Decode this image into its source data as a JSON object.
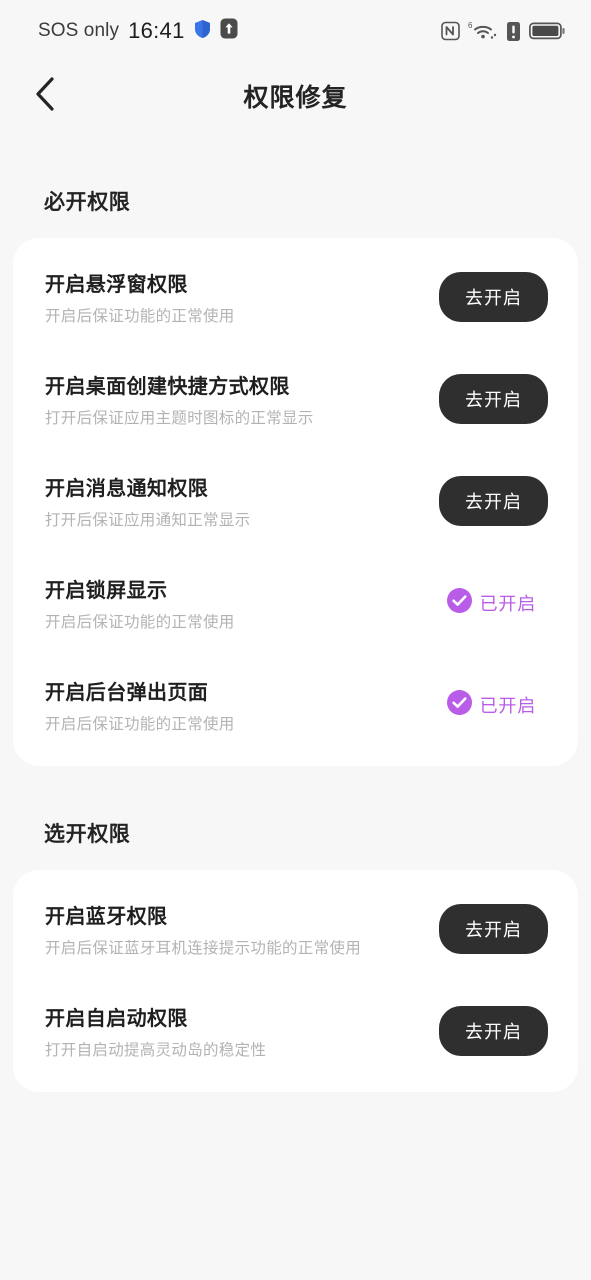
{
  "status_bar": {
    "carrier": "SOS only",
    "time": "16:41",
    "left_icons": [
      "shield-icon",
      "vpn-arrow-icon"
    ],
    "right_icons": [
      "nfc-icon",
      "wifi-6-icon",
      "sim-alert-icon",
      "battery-icon"
    ],
    "network_generation": "6"
  },
  "nav": {
    "back_icon": "chevron-left-icon",
    "title": "权限修复"
  },
  "colors": {
    "page_background": "#F7F7F7",
    "card_background": "#FFFFFF",
    "button_background": "#2F2F2F",
    "accent_purple": "#B95CE8",
    "title_text": "#1F1F1F",
    "subtitle_text": "#B3B3B3"
  },
  "labels": {
    "action_go_enable": "去开启",
    "status_enabled": "已开启"
  },
  "sections": [
    {
      "header": "必开权限",
      "rows": [
        {
          "title": "开启悬浮窗权限",
          "subtitle": "开启后保证功能的正常使用",
          "action_type": "button",
          "action_label": "去开启"
        },
        {
          "title": "开启桌面创建快捷方式权限",
          "subtitle": "打开后保证应用主题时图标的正常显示",
          "action_type": "button",
          "action_label": "去开启"
        },
        {
          "title": "开启消息通知权限",
          "subtitle": "打开后保证应用通知正常显示",
          "action_type": "button",
          "action_label": "去开启"
        },
        {
          "title": "开启锁屏显示",
          "subtitle": "开启后保证功能的正常使用",
          "action_type": "status",
          "action_label": "已开启"
        },
        {
          "title": "开启后台弹出页面",
          "subtitle": "开启后保证功能的正常使用",
          "action_type": "status",
          "action_label": "已开启"
        }
      ]
    },
    {
      "header": "选开权限",
      "rows": [
        {
          "title": "开启蓝牙权限",
          "subtitle": "开启后保证蓝牙耳机连接提示功能的正常使用",
          "action_type": "button",
          "action_label": "去开启"
        },
        {
          "title": "开启自启动权限",
          "subtitle": "打开自启动提高灵动岛的稳定性",
          "action_type": "button",
          "action_label": "去开启"
        }
      ]
    }
  ]
}
